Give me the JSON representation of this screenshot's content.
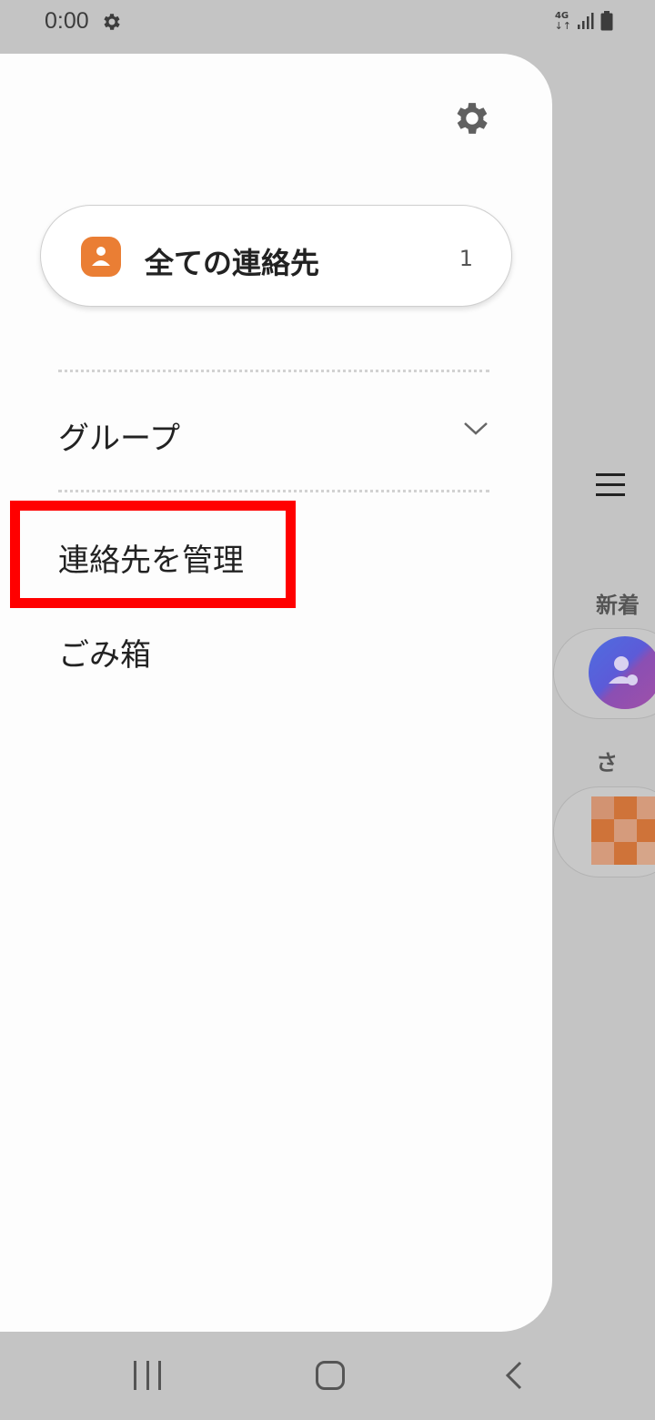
{
  "status_bar": {
    "time": "0:00",
    "network": "4G",
    "network_arrows": "↓↑"
  },
  "drawer": {
    "all_contacts": {
      "label": "全ての連絡先",
      "count": "1"
    },
    "menu": {
      "groups": "グループ",
      "manage_contacts": "連絡先を管理",
      "trash": "ごみ箱"
    }
  },
  "background": {
    "section_new": "新着",
    "section_sa": "さ"
  },
  "colors": {
    "highlight": "#ff0000",
    "contact_icon": "#ea7e34",
    "scrim": "#c4c4c4"
  }
}
